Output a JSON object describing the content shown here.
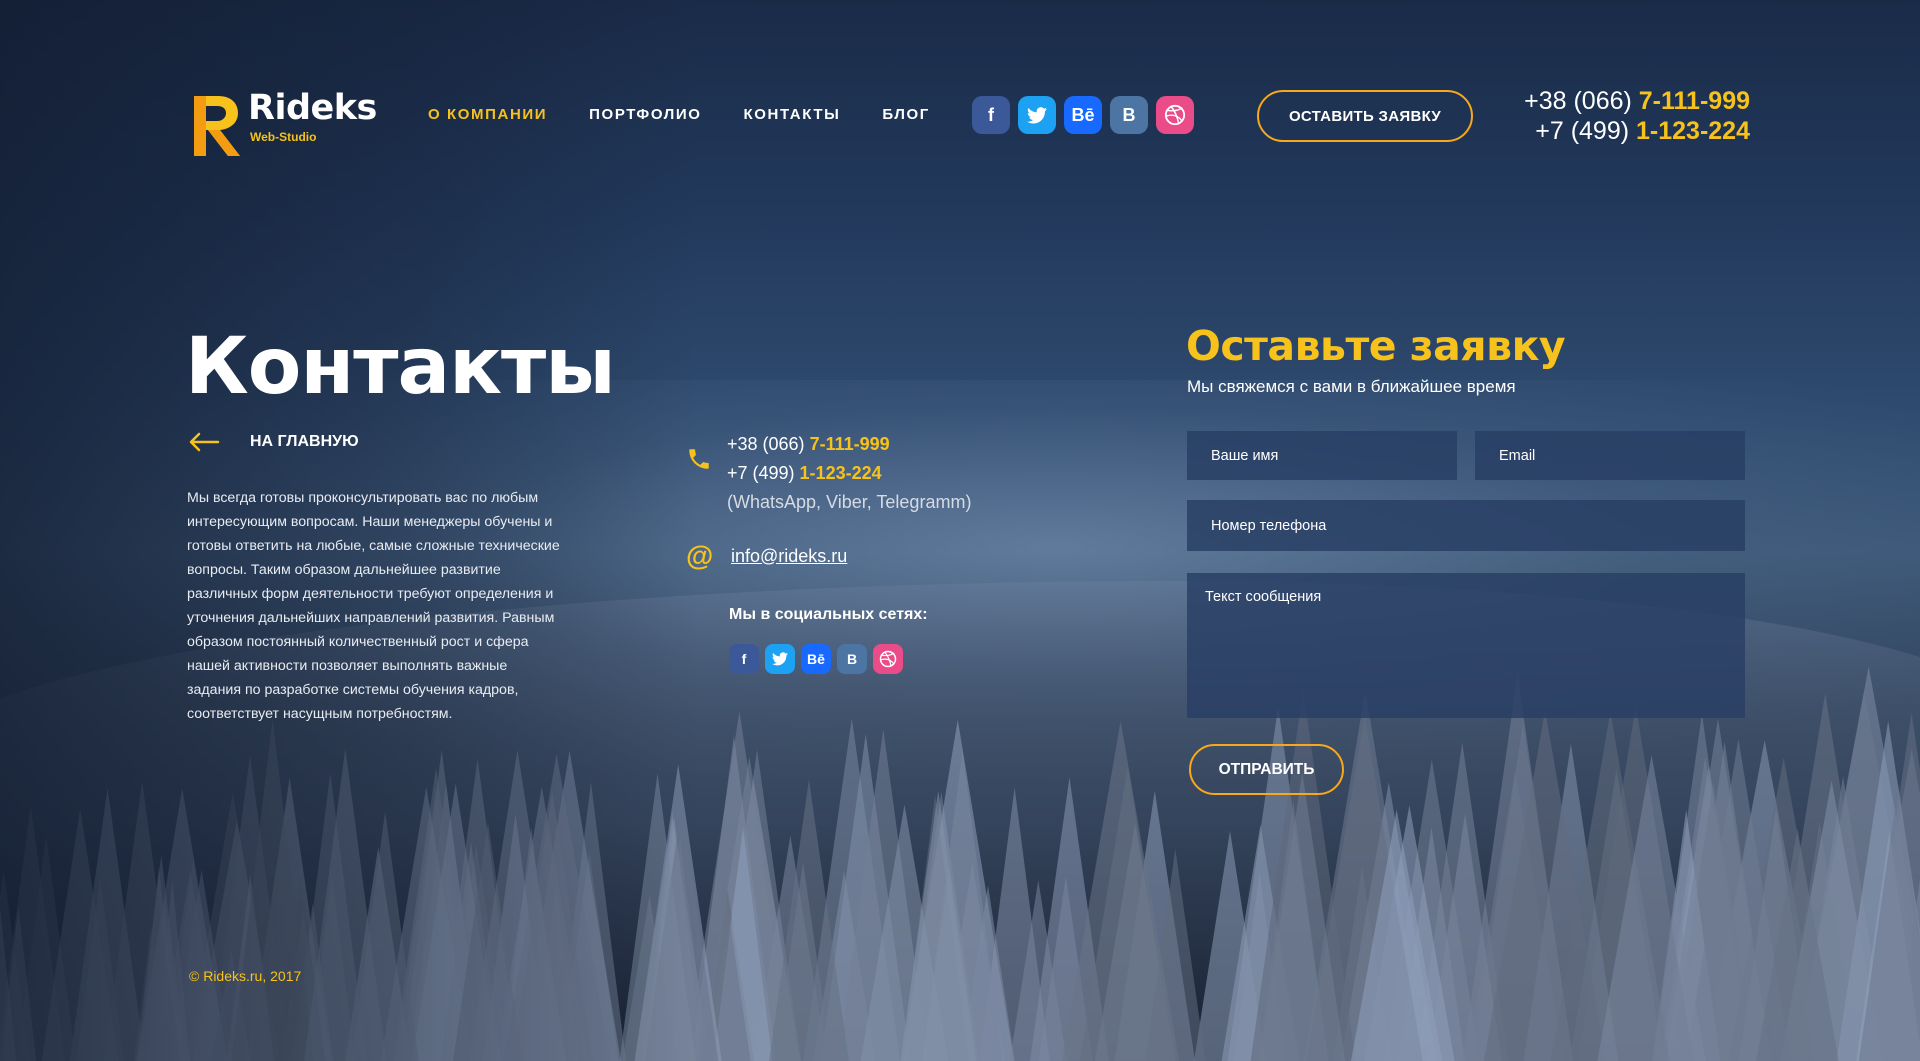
{
  "header": {
    "logo_name": "Rideks",
    "logo_sub": "Web-Studio",
    "nav": [
      {
        "label": "О КОМПАНИИ",
        "active": true
      },
      {
        "label": "ПОРТФОЛИО",
        "active": false
      },
      {
        "label": "КОНТАКТЫ",
        "active": false
      },
      {
        "label": "БЛОГ",
        "active": false
      }
    ],
    "socials": [
      {
        "icon": "facebook-icon",
        "glyph": "f"
      },
      {
        "icon": "twitter-icon",
        "glyph": "🐦"
      },
      {
        "icon": "behance-icon",
        "glyph": "Bē"
      },
      {
        "icon": "vk-icon",
        "glyph": "B"
      },
      {
        "icon": "dribbble-icon",
        "glyph": "◎"
      }
    ],
    "cta_label": "ОСТАВИТЬ ЗАЯВКУ",
    "phone1_prefix": "+38 (066) ",
    "phone1_number": "7-111-999",
    "phone2_prefix": "+7 (499) ",
    "phone2_number": "1-123-224"
  },
  "main": {
    "title": "Контакты",
    "back_label": "НА ГЛАВНУЮ",
    "about": "Мы всегда готовы проконсультировать вас по любым интересующим вопросам. Наши менеджеры обучены и готовы ответить на любые, самые сложные технические вопросы. Таким образом дальнейшее развитие различных форм деятельности требуют определения и уточнения дальнейших направлений развития. Равным образом постоянный количественный рост и сфера нашей активности позволяет выполнять важные задания по разработке системы обучения кадров, соответствует насущным потребностям."
  },
  "contacts": {
    "phone1_prefix": "+38 (066) ",
    "phone1_number": "7-111-999",
    "phone2_prefix": "+7 (499) ",
    "phone2_number": "1-123-224",
    "messengers": "(WhatsApp, Viber, Telegramm)",
    "at_glyph": "@",
    "email": "info@rideks.ru",
    "social_title": "Мы в социальных сетях:"
  },
  "form": {
    "title": "Оставьте заявку",
    "subtitle": "Мы свяжемся с вами в ближайшее время",
    "name_placeholder": "Ваше имя",
    "email_placeholder": "Email",
    "phone_placeholder": "Номер телефона",
    "message_placeholder": "Текст сообщения",
    "submit_label": "ОТПРАВИТЬ"
  },
  "footer": {
    "copyright": "© Rideks.ru, 2017"
  },
  "colors": {
    "accent": "#f7c21b",
    "button_border": "#f7a81b",
    "field_bg": "#283e64"
  }
}
